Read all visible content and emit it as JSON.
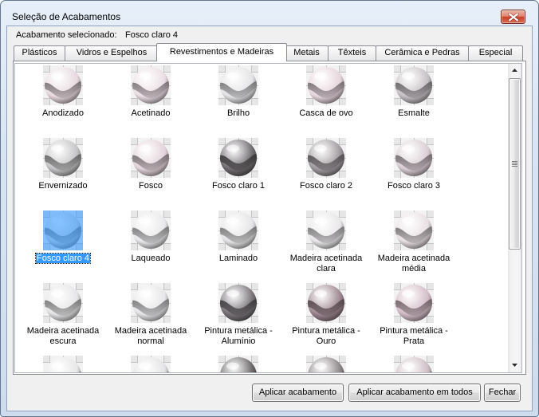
{
  "window": {
    "title": "Seleção de Acabamentos"
  },
  "selection": {
    "label": "Acabamento selecionado:",
    "value": "Fosco claro 4"
  },
  "tabs": [
    {
      "label": "Plásticos",
      "selected": false
    },
    {
      "label": "Vidros e Espelhos",
      "selected": false
    },
    {
      "label": "Revestimentos e Madeiras",
      "selected": true
    },
    {
      "label": "Metais",
      "selected": false
    },
    {
      "label": "Têxteis",
      "selected": false
    },
    {
      "label": "Cerâmica e Pedras",
      "selected": false
    },
    {
      "label": "Especial",
      "selected": false
    }
  ],
  "finishes": [
    {
      "label": "Anodizado",
      "tint": "#e7d9df"
    },
    {
      "label": "Acetinado",
      "tint": "#eadde3"
    },
    {
      "label": "Brilho",
      "tint": "#e3e3e5"
    },
    {
      "label": "Casca de ovo",
      "tint": "#e6d5dc"
    },
    {
      "label": "Esmalte",
      "tint": "#c6c0c4"
    },
    {
      "label": "Envernizado",
      "tint": "#c4c4c6"
    },
    {
      "label": "Fosco",
      "tint": "#e3d3da"
    },
    {
      "label": "Fosco claro 1",
      "tint": "#6f6b6e"
    },
    {
      "label": "Fosco claro 2",
      "tint": "#a09a9e"
    },
    {
      "label": "Fosco claro 3",
      "tint": "#dacdd3"
    },
    {
      "label": "Fosco claro 4",
      "tint": "#d8d8da",
      "selected": true
    },
    {
      "label": "Laqueado",
      "tint": "#e8e8ea"
    },
    {
      "label": "Laminado",
      "tint": "#e4e4e6"
    },
    {
      "label": "Madeira acetinada clara",
      "tint": "#e9e7e9"
    },
    {
      "label": "Madeira acetinada média",
      "tint": "#e8dfe3"
    },
    {
      "label": "Madeira acetinada escura",
      "tint": "#e5e5e7"
    },
    {
      "label": "Madeira acetinada normal",
      "tint": "#e6e6e8"
    },
    {
      "label": "Pintura metálica - Alumínio",
      "tint": "#787377"
    },
    {
      "label": "Pintura metálica - Ouro",
      "tint": "#9e8790"
    },
    {
      "label": "Pintura metálica - Prata",
      "tint": "#d3bcc6"
    }
  ],
  "finishes_partially_visible": [
    {
      "tint": "#e7e7e9"
    },
    {
      "tint": "#e3e3e5"
    },
    {
      "tint": "#6b6769"
    },
    {
      "tint": "#8e868a"
    },
    {
      "tint": "#cdbec5"
    }
  ],
  "scrollbar": {
    "scrolled_fraction": 0,
    "visible_content_fraction": 0.61
  },
  "buttons": {
    "apply": "Aplicar acabamento",
    "apply_all": "Aplicar acabamento em todos",
    "close": "Fechar"
  },
  "colors": {
    "selection_highlight": "#3399ff",
    "close_button": "#c8412a"
  },
  "icons": {
    "close": "close-icon",
    "scroll_up": "scroll-up-arrow-icon",
    "scroll_down": "scroll-down-arrow-icon",
    "scroll_grip": "scroll-grip-icon"
  }
}
